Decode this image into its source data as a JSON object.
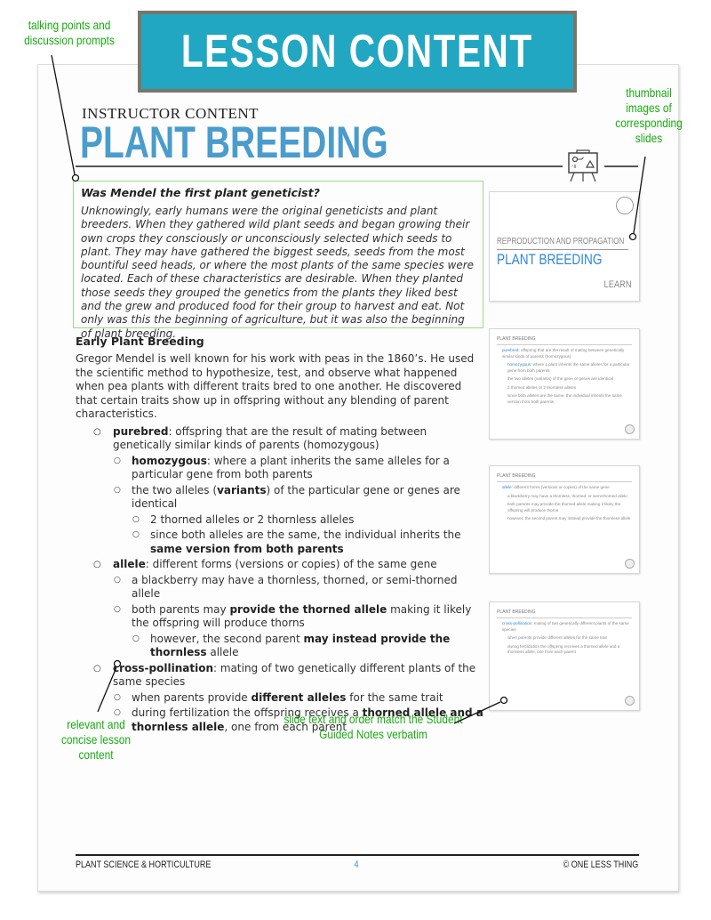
{
  "banner": {
    "title": "LESSON CONTENT"
  },
  "annotations": {
    "talking_points": "talking points and discussion prompts",
    "thumbnails": "thumbnail images of corresponding slides",
    "relevant": "relevant and concise lesson content",
    "slide_text": "slide text and order match the Student Guided Notes verbatim"
  },
  "header": {
    "eyebrow": "INSTRUCTOR CONTENT",
    "title": "PLANT BREEDING",
    "icon": "easel-presentation-icon"
  },
  "callout": {
    "question": "Was Mendel the first plant geneticist?",
    "paragraph": "Unknowingly, early humans were the original geneticists and plant breeders. When they gathered wild plant seeds and began growing their own crops they consciously or unconsciously selected which seeds to plant. They may have gathered the biggest seeds, seeds from the most bountiful seed heads, or where the most plants of the same species were located. Each of these characteristics are desirable. When they planted those seeds they grouped the genetics from the plants they liked best and the grew and produced food for their group to harvest and eat. Not only was this the beginning of agriculture, but it was also the beginning of plant breeding."
  },
  "section": {
    "heading": "Early Plant Breeding",
    "intro": "Gregor Mendel is well known for his work with peas in the 1860’s. He used the scientific method to hypothesize, test, and observe what happened when pea plants with different traits bred to one another. He discovered that certain traits show up in offspring without any blending of parent characteristics.",
    "items": [
      {
        "level": 1,
        "bold": "purebred",
        "text": ": offspring that are the result of mating between genetically similar kinds of parents (homozygous)"
      },
      {
        "level": 2,
        "bold": "homozygous",
        "text": ": where a plant inherits the same alleles for a particular gene from both parents"
      },
      {
        "level": 2,
        "pre": "the two alleles (",
        "bold": "variants",
        "text": ") of the particular gene or genes are identical"
      },
      {
        "level": 3,
        "text": "2 thorned alleles or 2 thornless alleles"
      },
      {
        "level": 3,
        "pre": "since both alleles are the same, the individual inherits the ",
        "bold": "same version from both parents",
        "text": ""
      },
      {
        "level": 1,
        "bold": "allele",
        "text": ": different forms (versions or copies) of the same gene"
      },
      {
        "level": 2,
        "text": "a blackberry may have a thornless, thorned, or semi-thorned allele"
      },
      {
        "level": 2,
        "pre": "both parents may ",
        "bold": "provide the thorned allele",
        "text": " making it likely the offspring will produce thorns"
      },
      {
        "level": 3,
        "pre": "however, the second parent ",
        "bold": "may instead provide the thornless",
        "text": " allele"
      },
      {
        "level": 1,
        "bold": "cross-pollination",
        "text": ": mating of two genetically different plants of the same species"
      },
      {
        "level": 2,
        "pre": "when parents provide ",
        "bold": "different alleles",
        "text": " for the same trait"
      },
      {
        "level": 2,
        "pre": "during fertilization the offspring receives a ",
        "bold": "thorned allele and a thornless allele",
        "text": ", one from each parent"
      }
    ]
  },
  "thumbnails": {
    "title_slide": {
      "subtitle": "REPRODUCTION AND PROPAGATION",
      "title": "PLANT BREEDING",
      "label": "LEARN"
    },
    "slides": [
      {
        "header": "PLANT BREEDING",
        "lines": [
          {
            "hl": "purebred:",
            "text": " offspring that are the result of mating between genetically similar kinds of parents (homozygous)"
          },
          {
            "hl": "homozygous:",
            "text": " where a plant inherits the same alleles for a particular gene from both parents"
          },
          {
            "hl": "",
            "text": "the two alleles (variants) of the gene or genes are identical"
          },
          {
            "hl": "",
            "text": "2 thorned alleles or 2 thornless alleles"
          },
          {
            "hl": "",
            "text": "since both alleles are the same, the individual inherits the same version from both parents"
          }
        ]
      },
      {
        "header": "PLANT BREEDING",
        "lines": [
          {
            "hl": "allele:",
            "text": " different forms (versions or copies) of the same gene"
          },
          {
            "hl": "",
            "text": "a blackberry may have a thornless, thorned, or semi-thorned allele"
          },
          {
            "hl": "",
            "text": "both parents may provide the thorned allele making it likely the offspring will produce thorns"
          },
          {
            "hl": "",
            "text": "however, the second parent may instead provide the thornless allele"
          }
        ]
      },
      {
        "header": "PLANT BREEDING",
        "lines": [
          {
            "hl": "cross-pollination:",
            "text": " mating of two genetically different plants of the same species"
          },
          {
            "hl": "",
            "text": "when parents provide different alleles for the same trait"
          },
          {
            "hl": "",
            "text": "during fertilization the offspring receives a thorned allele and a thornless allele, one from each parent"
          }
        ]
      }
    ]
  },
  "footer": {
    "left": "PLANT SCIENCE & HORTICULTURE",
    "page": "4",
    "right": "© ONE LESS THING"
  },
  "colors": {
    "banner": "#21a7c2",
    "title": "#4a9ccc",
    "annotation": "#1aab12",
    "callout_border": "#9fd98a"
  }
}
